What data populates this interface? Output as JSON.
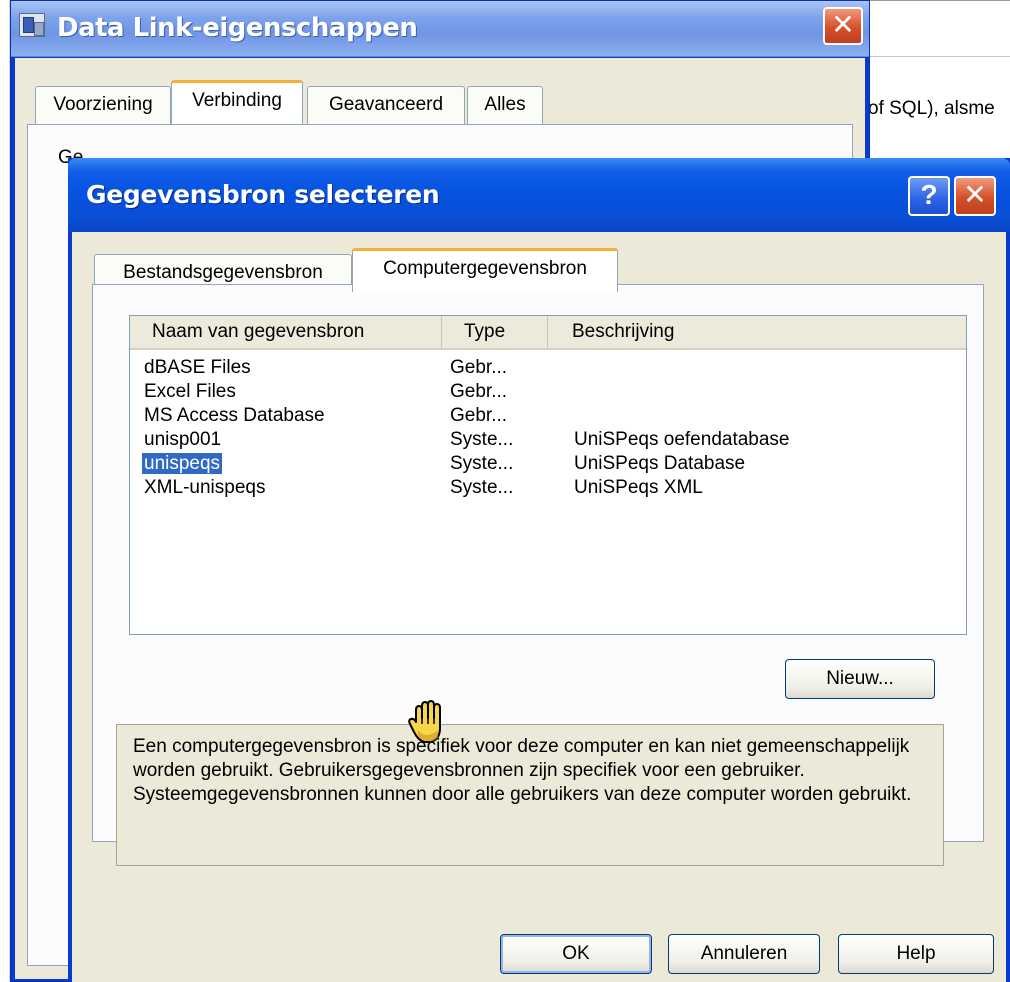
{
  "background_app": {
    "partial_text": "of SQL), alsme"
  },
  "data_link_dialog": {
    "title": "Data Link-eigenschappen",
    "close_glyph": "✕",
    "tabs": [
      "Voorziening",
      "Verbinding",
      "Geavanceerd",
      "Alles"
    ],
    "active_tab": "Verbinding",
    "partial_text": "Ge…"
  },
  "select_source_dialog": {
    "title": "Gegevensbron selecteren",
    "help_glyph": "?",
    "close_glyph": "✕",
    "tabs": [
      "Bestandsgegevensbron",
      "Computergegevensbron"
    ],
    "active_tab": "Computergegevensbron",
    "list": {
      "columns": [
        "Naam van gegevensbron",
        "Type",
        "Beschrijving"
      ],
      "rows": [
        {
          "name": "dBASE Files",
          "type": "Gebr...",
          "description": ""
        },
        {
          "name": "Excel Files",
          "type": "Gebr...",
          "description": ""
        },
        {
          "name": "MS Access Database",
          "type": "Gebr...",
          "description": ""
        },
        {
          "name": "unisp001",
          "type": "Syste...",
          "description": "UniSPeqs oefendatabase"
        },
        {
          "name": "unispeqs",
          "type": "Syste...",
          "description": "UniSPeqs Database"
        },
        {
          "name": "XML-unispeqs",
          "type": "Syste...",
          "description": "UniSPeqs XML"
        }
      ],
      "selected_row": "unispeqs"
    },
    "new_button": "Nieuw...",
    "description_text": "Een computergegevensbron is specifiek voor deze computer en kan niet gemeenschappelijk worden gebruikt. Gebruikersgegevensbronnen zijn specifiek voor een gebruiker. Systeemgegevensbronnen kunnen door alle gebruikers van deze computer worden gebruikt.",
    "buttons": {
      "ok": "OK",
      "cancel": "Annuleren",
      "help": "Help"
    }
  },
  "colors": {
    "title_blue": "#0552e0",
    "selection": "#316ac5",
    "dialog_face": "#ece9d8",
    "active_tab_accent": "#f4b23c",
    "close_red": "#d4502a"
  }
}
